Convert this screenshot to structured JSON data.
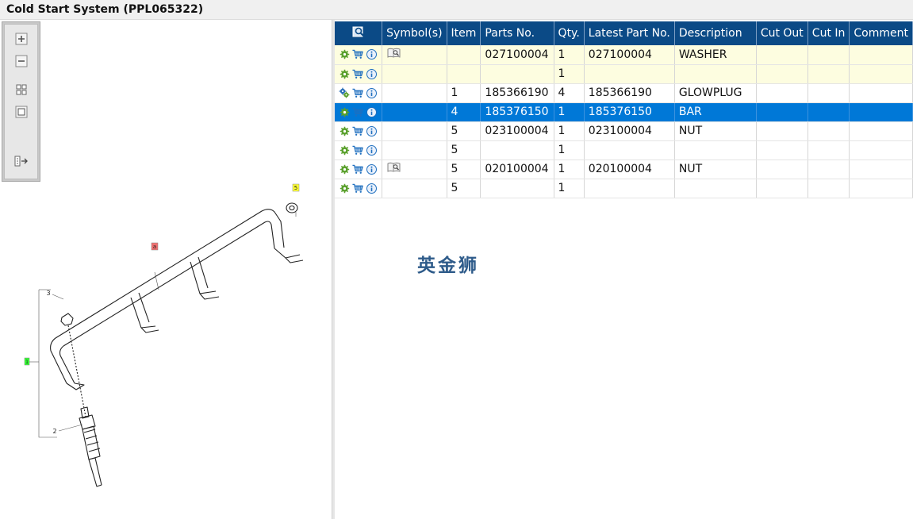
{
  "window": {
    "title": "Cold Start System (PPL065322)"
  },
  "toolbar": {
    "zoom_in": "zoom-in-icon",
    "zoom_out": "zoom-out-icon",
    "fit_all": "fit-all-icon",
    "fit_page": "fit-page-icon",
    "export": "export-icon"
  },
  "diagram": {
    "callouts": [
      "5",
      "a",
      "3",
      "1",
      "2"
    ]
  },
  "table": {
    "headers": [
      "",
      "Symbol(s)",
      "Item",
      "Parts No.",
      "Qty.",
      "Latest Part No.",
      "Description",
      "Cut Out",
      "Cut In",
      "Comment"
    ],
    "rows": [
      {
        "symbol": "book-icon",
        "item": "",
        "parts_no": "027100004",
        "qty": "1",
        "latest": "027100004",
        "desc": "WASHER",
        "cut_out": "",
        "cut_in": "",
        "comment": "",
        "state": "hl",
        "gear": "single"
      },
      {
        "symbol": "",
        "item": "",
        "parts_no": "",
        "qty": "1",
        "latest": "",
        "desc": "",
        "cut_out": "",
        "cut_in": "",
        "comment": "",
        "state": "hl",
        "gear": "single"
      },
      {
        "symbol": "",
        "item": "1",
        "parts_no": "185366190",
        "qty": "4",
        "latest": "185366190",
        "desc": "GLOWPLUG",
        "cut_out": "",
        "cut_in": "",
        "comment": "",
        "state": "",
        "gear": "double"
      },
      {
        "symbol": "",
        "item": "4",
        "parts_no": "185376150",
        "qty": "1",
        "latest": "185376150",
        "desc": "BAR",
        "cut_out": "",
        "cut_in": "",
        "comment": "",
        "state": "sel",
        "gear": "single"
      },
      {
        "symbol": "",
        "item": "5",
        "parts_no": "023100004",
        "qty": "1",
        "latest": "023100004",
        "desc": "NUT",
        "cut_out": "",
        "cut_in": "",
        "comment": "",
        "state": "",
        "gear": "single"
      },
      {
        "symbol": "",
        "item": "5",
        "parts_no": "",
        "qty": "1",
        "latest": "",
        "desc": "",
        "cut_out": "",
        "cut_in": "",
        "comment": "",
        "state": "",
        "gear": "single"
      },
      {
        "symbol": "book-icon",
        "item": "5",
        "parts_no": "020100004",
        "qty": "1",
        "latest": "020100004",
        "desc": "NUT",
        "cut_out": "",
        "cut_in": "",
        "comment": "",
        "state": "",
        "gear": "single"
      },
      {
        "symbol": "",
        "item": "5",
        "parts_no": "",
        "qty": "1",
        "latest": "",
        "desc": "",
        "cut_out": "",
        "cut_in": "",
        "comment": "",
        "state": "",
        "gear": "single"
      }
    ]
  },
  "watermark": {
    "text": "英金狮"
  },
  "colors": {
    "header_bg": "#0b4a86",
    "selected_row": "#0078d7",
    "highlight_row": "#fdfde0",
    "gear_green": "#5aa02c",
    "cart_blue": "#1f6fbf"
  }
}
